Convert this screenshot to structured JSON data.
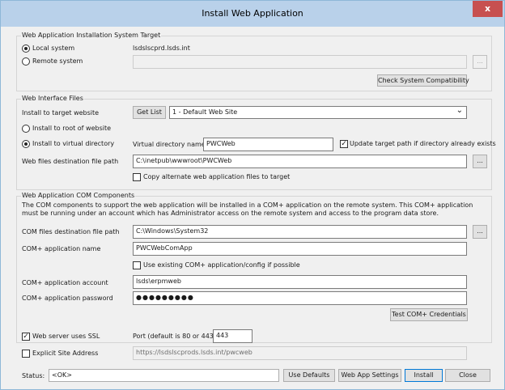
{
  "window": {
    "title": "Install Web Application",
    "close_glyph": "x"
  },
  "target": {
    "legend": "Web Application Installation System Target",
    "local_label": "Local system",
    "local_checked": true,
    "local_host": "lsdslscprd.lsds.int",
    "remote_label": "Remote system",
    "remote_checked": false,
    "remote_value": "",
    "browse_glyph": "...",
    "check_button": "Check System Compatibility"
  },
  "web": {
    "legend": "Web Interface Files",
    "install_to_label": "Install to target website",
    "get_list_button": "Get List",
    "website_select": "1 - Default Web Site",
    "root_label": "Install to root of website",
    "root_checked": false,
    "virtual_label": "Install to virtual directory",
    "virtual_checked": true,
    "vdir_label": "Virtual directory name",
    "vdir_value": "PWCWeb",
    "update_label": "Update target path if directory already exists",
    "update_checked": true,
    "dest_label": "Web files destination file path",
    "dest_value": "C:\\inetpub\\wwwroot\\PWCWeb",
    "browse_glyph": "...",
    "copy_label": "Copy alternate web application files to target",
    "copy_checked": false
  },
  "com": {
    "legend": "Web Application COM Components",
    "description": "The COM components to support the web application will be installed in a COM+ application on the remote system.  This COM+ application must be running under an account which has Administrator access on the remote system and access to the program data store.",
    "dest_label": "COM files destination file path",
    "dest_value": "C:\\Windows\\System32",
    "browse_glyph": "...",
    "app_name_label": "COM+ application name",
    "app_name_value": "PWCWebComApp",
    "use_existing_label": "Use existing COM+ application/config if possible",
    "use_existing_checked": false,
    "account_label": "COM+ application account",
    "account_value": "lsds\\erpmweb",
    "password_label": "COM+ application password",
    "password_value": "●●●●●●●●●",
    "test_button": "Test COM+ Credentials"
  },
  "ssl": {
    "label": "Web server uses SSL",
    "checked": true,
    "port_label": "Port (default is 80 or 443)",
    "port_value": "443"
  },
  "site": {
    "label": "Explicit Site Address",
    "checked": false,
    "value": "https://lsdslscprods.lsds.int/pwcweb"
  },
  "footer": {
    "status_label": "Status:",
    "status_value": "<OK>",
    "use_defaults": "Use Defaults",
    "settings": "Web App Settings",
    "install": "Install",
    "close": "Close"
  },
  "icons": {
    "check_mark": "✓",
    "dropdown": "⌄"
  }
}
